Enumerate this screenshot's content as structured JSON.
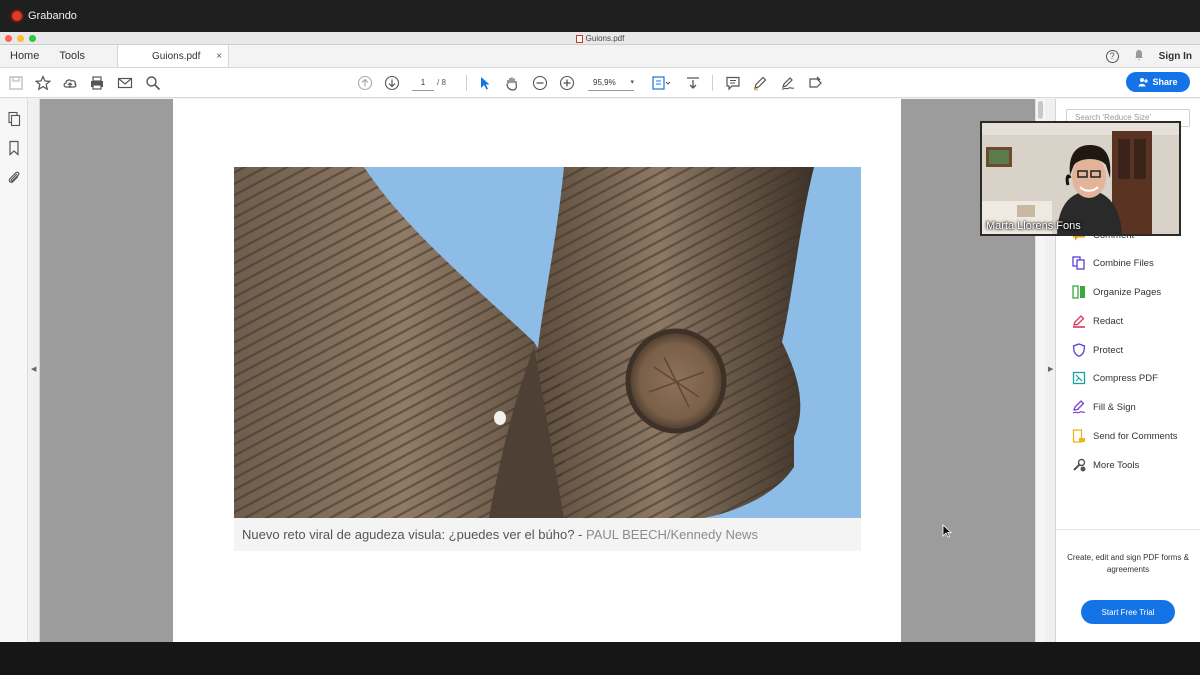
{
  "recording": {
    "label": "Grabando",
    "dot_color": "#e0392f"
  },
  "window": {
    "title": "Guions.pdf"
  },
  "tabs": {
    "home": "Home",
    "tools": "Tools",
    "document": "Guions.pdf",
    "close": "×"
  },
  "header": {
    "help": "?",
    "sign_in": "Sign In"
  },
  "toolbar": {
    "page_current": "1",
    "page_total": "/ 8",
    "zoom": "95,9%",
    "zoom_caret": "▾",
    "share": "Share",
    "accent": "#1473e6"
  },
  "document": {
    "caption_main": "Nuevo reto viral de agudeza visula: ¿puedes ver el búho? - ",
    "caption_source": "PAUL BEECH/Kennedy News"
  },
  "tools_panel": {
    "search_placeholder": "Search 'Reduce Size'",
    "items": [
      {
        "label": "Comment",
        "icon": "comment-icon",
        "color": "#e8a317"
      },
      {
        "label": "Combine Files",
        "icon": "combine-files-icon",
        "color": "#5a3fd6"
      },
      {
        "label": "Organize Pages",
        "icon": "organize-pages-icon",
        "color": "#3fa53f"
      },
      {
        "label": "Redact",
        "icon": "redact-icon",
        "color": "#e0335c"
      },
      {
        "label": "Protect",
        "icon": "protect-icon",
        "color": "#5a3fd6"
      },
      {
        "label": "Compress PDF",
        "icon": "compress-pdf-icon",
        "color": "#15a3a3"
      },
      {
        "label": "Fill & Sign",
        "icon": "fill-sign-icon",
        "color": "#7a3fd6"
      },
      {
        "label": "Send for Comments",
        "icon": "send-comments-icon",
        "color": "#e8b717"
      },
      {
        "label": "More Tools",
        "icon": "more-tools-icon",
        "color": "#555555"
      }
    ],
    "promo": "Create, edit and sign PDF forms & agreements",
    "trial_button": "Start Free Trial"
  },
  "webcam": {
    "name": "Marta Llorens Fons"
  }
}
